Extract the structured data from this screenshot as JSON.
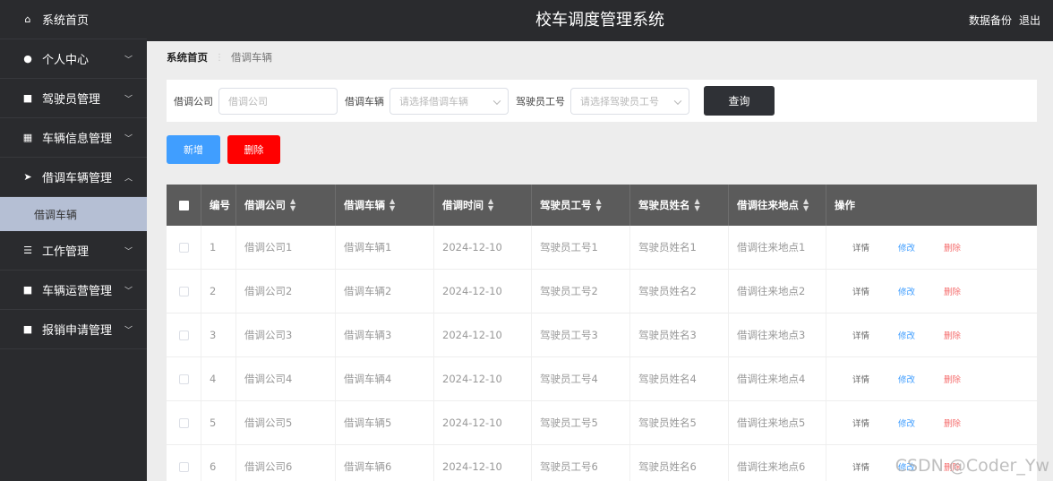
{
  "sidebar": {
    "items": [
      {
        "label": "系统首页",
        "icon": "home-icon",
        "glyph": "⌂",
        "chevron": ""
      },
      {
        "label": "个人中心",
        "icon": "user-icon",
        "glyph": "●",
        "chevron": "﹀"
      },
      {
        "label": "驾驶员管理",
        "icon": "grid-icon",
        "glyph": "■",
        "chevron": "﹀"
      },
      {
        "label": "车辆信息管理",
        "icon": "table-icon",
        "glyph": "▦",
        "chevron": "﹀"
      },
      {
        "label": "借调车辆管理",
        "icon": "send-icon",
        "glyph": "➤",
        "chevron": "︿"
      },
      {
        "label": "工作管理",
        "icon": "list-icon",
        "glyph": "☰",
        "chevron": "﹀"
      },
      {
        "label": "车辆运营管理",
        "icon": "grid-icon",
        "glyph": "■",
        "chevron": "﹀"
      },
      {
        "label": "报销申请管理",
        "icon": "grid-icon",
        "glyph": "■",
        "chevron": "﹀"
      }
    ],
    "sub_active": "借调车辆"
  },
  "header": {
    "title": "校车调度管理系统",
    "backup": "数据备份",
    "logout": "退出"
  },
  "breadcrumb": {
    "home": "系统首页",
    "current": "借调车辆"
  },
  "search": {
    "company_label": "借调公司",
    "company_placeholder": "借调公司",
    "vehicle_label": "借调车辆",
    "vehicle_placeholder": "请选择借调车辆",
    "driver_label": "驾驶员工号",
    "driver_placeholder": "请选择驾驶员工号",
    "query": "查询"
  },
  "actions": {
    "add": "新增",
    "delete": "删除"
  },
  "table": {
    "headers": [
      "编号",
      "借调公司",
      "借调车辆",
      "借调时间",
      "驾驶员工号",
      "驾驶员姓名",
      "借调往来地点",
      "操作"
    ],
    "ops": {
      "detail": "详情",
      "edit": "修改",
      "delete": "删除"
    },
    "rows": [
      {
        "id": "1",
        "company": "借调公司1",
        "vehicle": "借调车辆1",
        "time": "2024-12-10",
        "driver_no": "驾驶员工号1",
        "driver_name": "驾驶员姓名1",
        "place": "借调往来地点1"
      },
      {
        "id": "2",
        "company": "借调公司2",
        "vehicle": "借调车辆2",
        "time": "2024-12-10",
        "driver_no": "驾驶员工号2",
        "driver_name": "驾驶员姓名2",
        "place": "借调往来地点2"
      },
      {
        "id": "3",
        "company": "借调公司3",
        "vehicle": "借调车辆3",
        "time": "2024-12-10",
        "driver_no": "驾驶员工号3",
        "driver_name": "驾驶员姓名3",
        "place": "借调往来地点3"
      },
      {
        "id": "4",
        "company": "借调公司4",
        "vehicle": "借调车辆4",
        "time": "2024-12-10",
        "driver_no": "驾驶员工号4",
        "driver_name": "驾驶员姓名4",
        "place": "借调往来地点4"
      },
      {
        "id": "5",
        "company": "借调公司5",
        "vehicle": "借调车辆5",
        "time": "2024-12-10",
        "driver_no": "驾驶员工号5",
        "driver_name": "驾驶员姓名5",
        "place": "借调往来地点5"
      },
      {
        "id": "6",
        "company": "借调公司6",
        "vehicle": "借调车辆6",
        "time": "2024-12-10",
        "driver_no": "驾驶员工号6",
        "driver_name": "驾驶员姓名6",
        "place": "借调往来地点6"
      }
    ]
  },
  "watermark": "CSDN @Coder_Yw"
}
